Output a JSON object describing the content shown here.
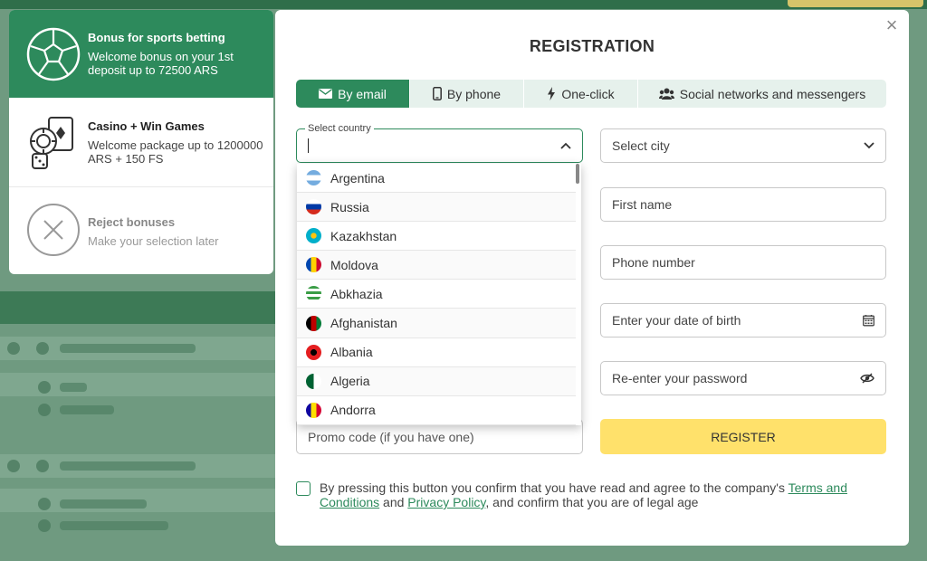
{
  "bonuses": [
    {
      "title": "Bonus for sports betting",
      "desc": "Welcome bonus on your 1st deposit up to 72500 ARS",
      "icon": "soccer-ball-icon"
    },
    {
      "title": "Casino + Win Games",
      "desc": "Welcome package up to 1200000 ARS + 150 FS",
      "icon": "casino-chips-icon"
    },
    {
      "title": "Reject bonuses",
      "desc": "Make your selection later",
      "icon": "reject-icon"
    }
  ],
  "modal": {
    "title": "REGISTRATION",
    "close": "×",
    "tabs": [
      {
        "label": "By email",
        "icon": "envelope-icon"
      },
      {
        "label": "By phone",
        "icon": "phone-icon"
      },
      {
        "label": "One-click",
        "icon": "lightning-icon"
      },
      {
        "label": "Social networks and messengers",
        "icon": "users-icon"
      }
    ],
    "country_label": "Select country",
    "city_placeholder": "Select city",
    "first_name_placeholder": "First name",
    "phone_placeholder": "Phone number",
    "dob_placeholder": "Enter your date of birth",
    "reenter_password_placeholder": "Re-enter your password",
    "promo_placeholder": "Promo code (if you have one)",
    "register_label": "REGISTER",
    "agree": {
      "before": "By pressing this button you confirm that you have read and agree to the company's ",
      "terms": "Terms and Conditions",
      "and": " and ",
      "privacy": "Privacy Policy",
      "after": ", and confirm that you are of legal age"
    },
    "countries": [
      "Argentina",
      "Russia",
      "Kazakhstan",
      "Moldova",
      "Abkhazia",
      "Afghanistan",
      "Albania",
      "Algeria",
      "Andorra"
    ]
  },
  "colors": {
    "accent": "#2d8a5c",
    "register": "#ffe16b"
  }
}
